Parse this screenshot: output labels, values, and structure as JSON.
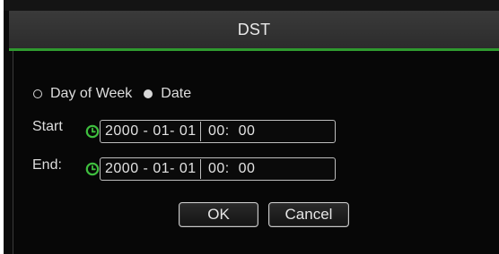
{
  "dialog": {
    "title": "DST"
  },
  "mode": {
    "options": [
      {
        "label": "Day of Week",
        "selected": false
      },
      {
        "label": "Date",
        "selected": true
      }
    ]
  },
  "start": {
    "label": "Start",
    "date": "2000 - 01- 01",
    "time": "00:  00",
    "icon": "clock-icon"
  },
  "end": {
    "label": "End:",
    "date": "2000 - 01- 01",
    "time": "00:  00",
    "icon": "clock-icon"
  },
  "buttons": {
    "ok_label": "OK",
    "cancel_label": "Cancel"
  },
  "colors": {
    "accent": "#2f9a2f",
    "background": "#0b0b0b",
    "text": "#e6e6e6"
  }
}
